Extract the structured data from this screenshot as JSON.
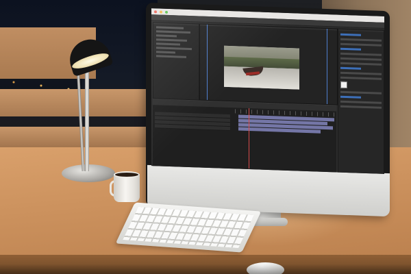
{
  "scene": {
    "colors": {
      "desk_wood": "#cc925e",
      "wall": "#2b2a28",
      "monitor_bezel": "#1a1a1a",
      "monitor_chin": "#e8e8e6",
      "app_background": "#2c2c2c",
      "accent_blue": "#3d6fb8",
      "timeline_track": "#8a8cc8"
    }
  },
  "monitor": {
    "app": {
      "menu_title": "",
      "workspace_tabs": [
        "",
        "",
        "",
        "",
        ""
      ],
      "panels": {
        "left_tab": "",
        "composition_tab": "",
        "timeline_tab": "",
        "right_tab": ""
      }
    }
  }
}
